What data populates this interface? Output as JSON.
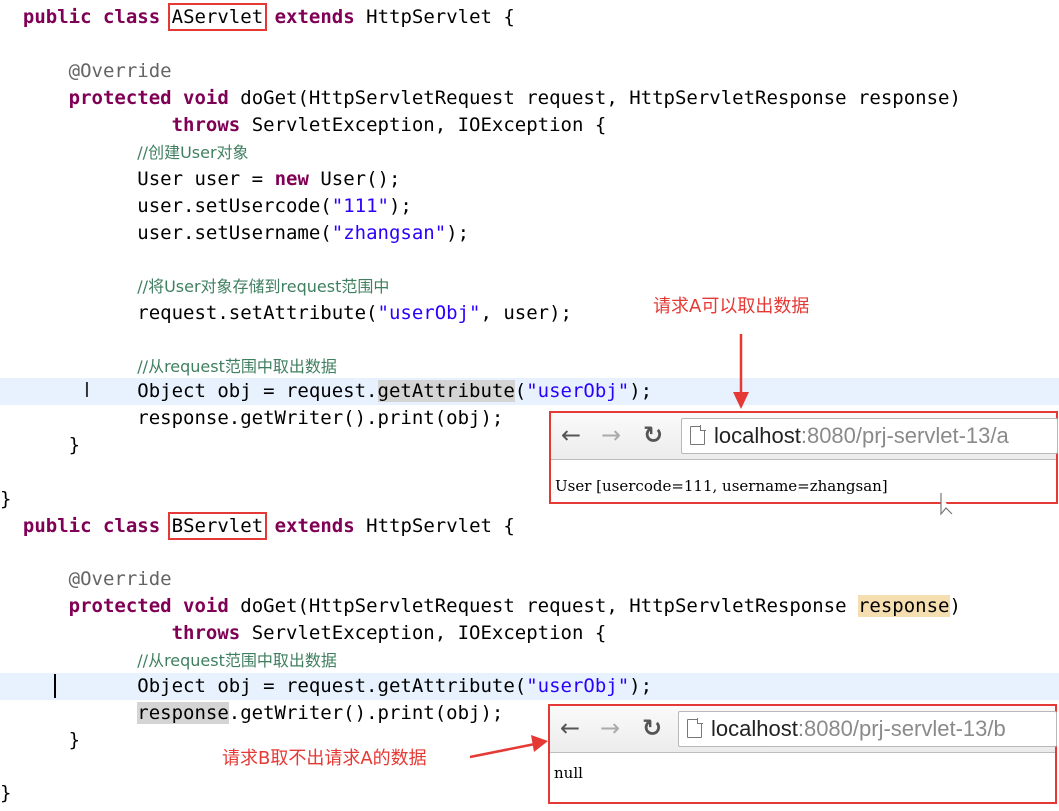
{
  "a_servlet": {
    "class_decl": {
      "kw_public": "public",
      "kw_class": "class",
      "name": "AServlet",
      "kw_extends": "extends",
      "parent": "HttpServlet {"
    },
    "annotation": "@Override",
    "method_decl": {
      "kw_protected": "protected",
      "kw_void": "void",
      "rest": "doGet(HttpServletRequest request, HttpServletResponse response)"
    },
    "throws_line": {
      "kw_throws": "throws",
      "rest": "ServletException, IOException {"
    },
    "comment_create": "//创建User对象",
    "new_user": {
      "pre": "User user = ",
      "kw_new": "new",
      "post": "User();"
    },
    "set_code": {
      "pre": "user.setUsercode(",
      "str": "\"111\"",
      "post": ");"
    },
    "set_name": {
      "pre": "user.setUsername(",
      "str": "\"zhangsan\"",
      "post": ");"
    },
    "comment_store": "//将User对象存储到request范围中",
    "set_attr": {
      "pre": "request.setAttribute(",
      "str": "\"userObj\"",
      "post": ", user);"
    },
    "comment_get": "//从request范围中取出数据",
    "get_attr": {
      "pre": "Object obj = request.",
      "occ": "getAttribute",
      "mid": "(",
      "str": "\"userObj\"",
      "post": ");"
    },
    "print": "response.getWriter().print(obj);",
    "close_method": "}",
    "close_class": "}"
  },
  "b_servlet": {
    "class_decl": {
      "kw_public": "public",
      "kw_class": "class",
      "name": "BServlet",
      "kw_extends": "extends",
      "parent": "HttpServlet {"
    },
    "annotation": "@Override",
    "method_decl": {
      "kw_protected": "protected",
      "kw_void": "void",
      "rest": "doGet(HttpServletRequest request, HttpServletResponse ",
      "marked": "response",
      "end": ")"
    },
    "throws_line": {
      "kw_throws": "throws",
      "rest": "ServletException, IOException {"
    },
    "comment_get": "//从request范围中取出数据",
    "get_attr": {
      "pre": "Object obj = request.getAttribute(",
      "str": "\"userObj\"",
      "post": ");"
    },
    "print": {
      "occ": "response",
      "rest": ".getWriter().print(obj);"
    },
    "close_method": "}",
    "close_class": "}"
  },
  "browser_a": {
    "back_icon": "←",
    "forward_icon": "→",
    "reload_icon": "↻",
    "url_host": "localhost",
    "url_rest": ":8080/prj-servlet-13/a",
    "content": "User [usercode=111, username=zhangsan]"
  },
  "browser_b": {
    "back_icon": "←",
    "forward_icon": "→",
    "reload_icon": "↻",
    "url_host": "localhost",
    "url_rest": ":8080/prj-servlet-13/b",
    "content": "null"
  },
  "annotations": {
    "callout_a": "请求A可以取出数据",
    "callout_b": "请求B取不出请求A的数据"
  },
  "colors": {
    "keyword": "#7f0055",
    "string": "#2a00ff",
    "comment": "#3f7f5f",
    "annotation": "#646464",
    "highlight_red": "#e53935",
    "current_line": "#e8f2fe"
  }
}
